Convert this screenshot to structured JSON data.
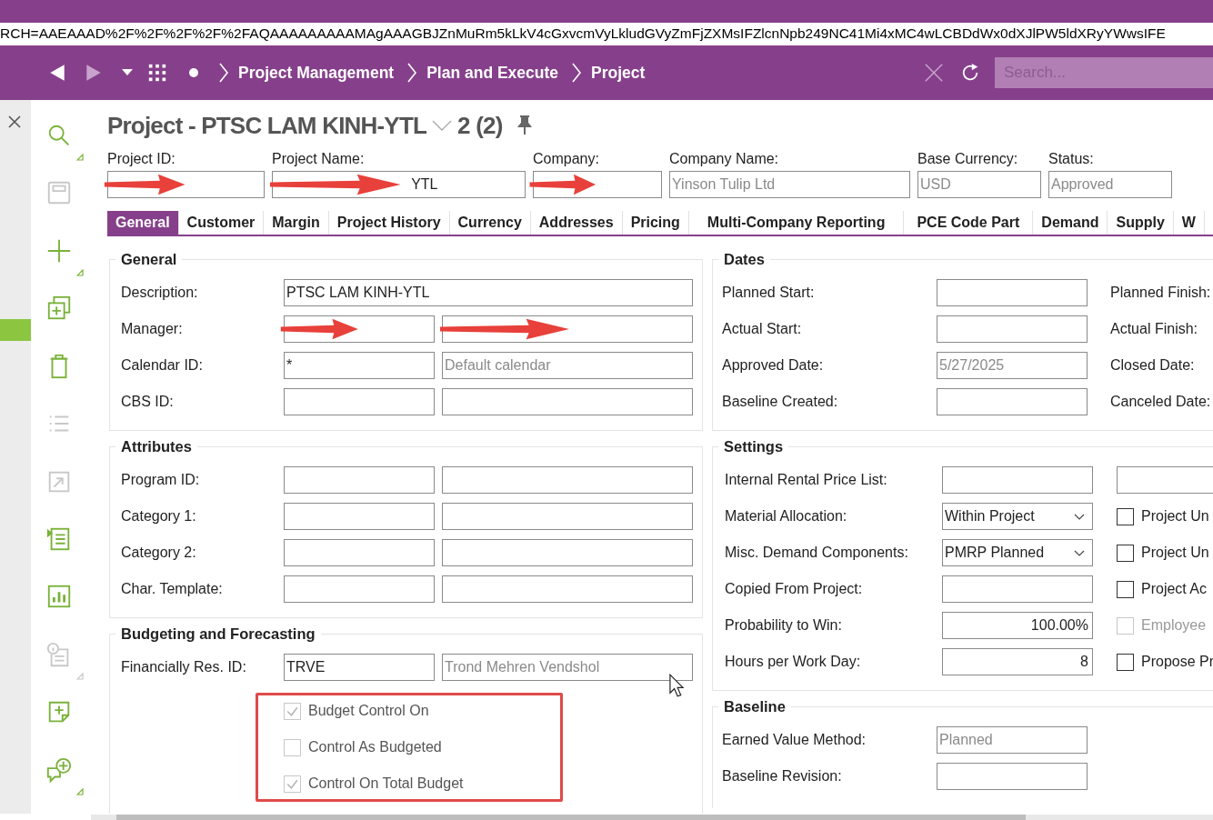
{
  "url": "RCH=AAEAAAD%2F%2F%2F%2F%2FAQAAAAAAAAAMAgAAAGBJZnMuRm5kLkV4cGxvcmVyLkludGVyZmFjZXMsIFZlcnNpb249NC41Mi4xMC4wLCBDdWx0dXJlPW5ldXRyYWwsIFE",
  "nav": {
    "crumbs": [
      "Project Management",
      "Plan and Execute",
      "Project"
    ],
    "search_placeholder": "Search..."
  },
  "sidebar_tools": [
    {
      "kind": "search",
      "disabled": false,
      "menu": true
    },
    {
      "kind": "save",
      "disabled": true
    },
    {
      "kind": "add",
      "disabled": false,
      "menu": true
    },
    {
      "kind": "copy",
      "disabled": false
    },
    {
      "kind": "delete",
      "disabled": false
    },
    {
      "kind": "list",
      "disabled": true
    },
    {
      "kind": "export",
      "disabled": true
    },
    {
      "kind": "outline",
      "disabled": false
    },
    {
      "kind": "chart",
      "disabled": false
    },
    {
      "kind": "info",
      "disabled": true,
      "menu": true
    },
    {
      "kind": "note",
      "disabled": false
    },
    {
      "kind": "comment",
      "disabled": false,
      "menu": true
    }
  ],
  "page": {
    "title": "Project - PTSC LAM KINH-YTL",
    "count": "2 (2)"
  },
  "header_fields": [
    {
      "label": "Project ID:",
      "redacted": true
    },
    {
      "label": "Project Name:",
      "value": "YTL",
      "redacted": true
    },
    {
      "label": "Company:",
      "redacted": true
    },
    {
      "label": "Company Name:",
      "value": "Yinson Tulip Ltd",
      "readonly": true,
      "redacted": false
    },
    {
      "label": "Base Currency:",
      "value": "USD",
      "readonly": true,
      "redacted": false
    },
    {
      "label": "Status:",
      "value": "Approved",
      "readonly": true,
      "redacted": false
    }
  ],
  "tabs": [
    {
      "label": "General",
      "selected": true
    },
    {
      "label": "Customer",
      "selected": false
    },
    {
      "label": "Margin",
      "selected": false
    },
    {
      "label": "Project History",
      "selected": false
    },
    {
      "label": "Currency",
      "selected": false
    },
    {
      "label": "Addresses",
      "selected": false
    },
    {
      "label": "Pricing",
      "selected": false
    },
    {
      "label": "Multi-Company Reporting",
      "selected": false
    },
    {
      "label": "PCE Code Part",
      "selected": false
    },
    {
      "label": "Demand",
      "selected": false
    },
    {
      "label": "Supply",
      "selected": false
    },
    {
      "label": "W",
      "selected": false
    }
  ],
  "general": {
    "title": "General",
    "rows": [
      {
        "label": "Description:",
        "fields": [
          {
            "kind": "wide",
            "value": "PTSC LAM KINH-YTL",
            "readonly": false,
            "redacted": false
          }
        ]
      },
      {
        "label": "Manager:",
        "fields": [
          {
            "kind": "text",
            "redacted": true
          },
          {
            "kind": "text",
            "redacted": true
          }
        ]
      },
      {
        "label": "Calendar ID:",
        "fields": [
          {
            "kind": "text",
            "value": "*",
            "readonly": false,
            "redacted": false
          },
          {
            "kind": "text",
            "value": "Default calendar",
            "readonly": true,
            "redacted": false
          }
        ]
      },
      {
        "label": "CBS ID:",
        "fields": [
          {
            "kind": "text",
            "redacted": false
          },
          {
            "kind": "text",
            "redacted": false
          }
        ]
      }
    ]
  },
  "attributes": {
    "title": "Attributes",
    "rows": [
      {
        "label": "Program ID:",
        "fields": [
          {
            "kind": "text",
            "redacted": false
          },
          {
            "kind": "text",
            "redacted": false
          }
        ]
      },
      {
        "label": "Category 1:",
        "fields": [
          {
            "kind": "text",
            "redacted": false
          },
          {
            "kind": "text",
            "redacted": false
          }
        ]
      },
      {
        "label": "Category 2:",
        "fields": [
          {
            "kind": "text",
            "redacted": false
          },
          {
            "kind": "text",
            "redacted": false
          }
        ]
      },
      {
        "label": "Char. Template:",
        "fields": [
          {
            "kind": "text",
            "redacted": false
          },
          {
            "kind": "text",
            "redacted": false
          }
        ]
      }
    ]
  },
  "budgeting": {
    "title": "Budgeting and Forecasting",
    "rows": [
      {
        "label": "Financially Res. ID:",
        "fields": [
          {
            "kind": "text",
            "value": "TRVE",
            "readonly": false,
            "redacted": false
          },
          {
            "kind": "text",
            "value": "Trond Mehren Vendshol",
            "readonly": true,
            "redacted": false
          }
        ]
      }
    ],
    "checkboxes": [
      {
        "label": "Budget Control On",
        "checked": true,
        "disabled": true
      },
      {
        "label": "Control As Budgeted",
        "checked": false,
        "disabled": true
      },
      {
        "label": "Control On Total Budget",
        "checked": true,
        "disabled": true
      }
    ],
    "highlighted": true
  },
  "dates": {
    "title": "Dates",
    "rows": [
      {
        "label": "Planned Start:",
        "fields": [
          {
            "kind": "text",
            "redacted": false
          }
        ],
        "side_label": "Planned Finish:"
      },
      {
        "label": "Actual Start:",
        "fields": [
          {
            "kind": "text",
            "redacted": false
          }
        ],
        "side_label": "Actual Finish:"
      },
      {
        "label": "Approved Date:",
        "fields": [
          {
            "kind": "text",
            "value": "5/27/2025",
            "readonly": true,
            "redacted": false
          }
        ],
        "side_label": "Closed Date:"
      },
      {
        "label": "Baseline Created:",
        "fields": [
          {
            "kind": "text",
            "redacted": false
          }
        ],
        "side_label": "Canceled Date:"
      }
    ]
  },
  "settings": {
    "title": "Settings",
    "rows": [
      {
        "label": "Internal Rental Price List:",
        "fields": [
          {
            "kind": "text",
            "redacted": false
          }
        ],
        "extra": {
          "kind": "field"
        }
      },
      {
        "label": "Material Allocation:",
        "fields": [
          {
            "kind": "select",
            "value": "Within Project",
            "readonly": false,
            "redacted": false
          }
        ],
        "extra": {
          "kind": "checkbox",
          "label": "Project Un",
          "checked": false,
          "disabled": false
        }
      },
      {
        "label": "Misc. Demand Components:",
        "fields": [
          {
            "kind": "select",
            "value": "PMRP Planned",
            "readonly": false,
            "redacted": false
          }
        ],
        "extra": {
          "kind": "checkbox",
          "label": "Project Un",
          "checked": false,
          "disabled": false
        }
      },
      {
        "label": "Copied From Project:",
        "fields": [
          {
            "kind": "text",
            "redacted": false
          }
        ],
        "extra": {
          "kind": "checkbox",
          "label": "Project Ac",
          "checked": false,
          "disabled": false
        }
      },
      {
        "label": "Probability to Win:",
        "fields": [
          {
            "kind": "number",
            "value": "100.00%",
            "readonly": false,
            "redacted": false
          }
        ],
        "extra": {
          "kind": "checkbox",
          "label": "Employee",
          "checked": false,
          "disabled": true
        }
      },
      {
        "label": "Hours per Work Day:",
        "fields": [
          {
            "kind": "number",
            "value": "8",
            "readonly": false,
            "redacted": false
          }
        ],
        "extra": {
          "kind": "checkbox",
          "label": "Propose Pr",
          "checked": false,
          "disabled": false
        }
      }
    ]
  },
  "baseline": {
    "title": "Baseline",
    "rows": [
      {
        "label": "Earned Value Method:",
        "fields": [
          {
            "kind": "text",
            "value": "Planned",
            "readonly": true,
            "redacted": false
          }
        ]
      },
      {
        "label": "Baseline Revision:",
        "fields": [
          {
            "kind": "text",
            "redacted": false
          }
        ]
      }
    ]
  }
}
